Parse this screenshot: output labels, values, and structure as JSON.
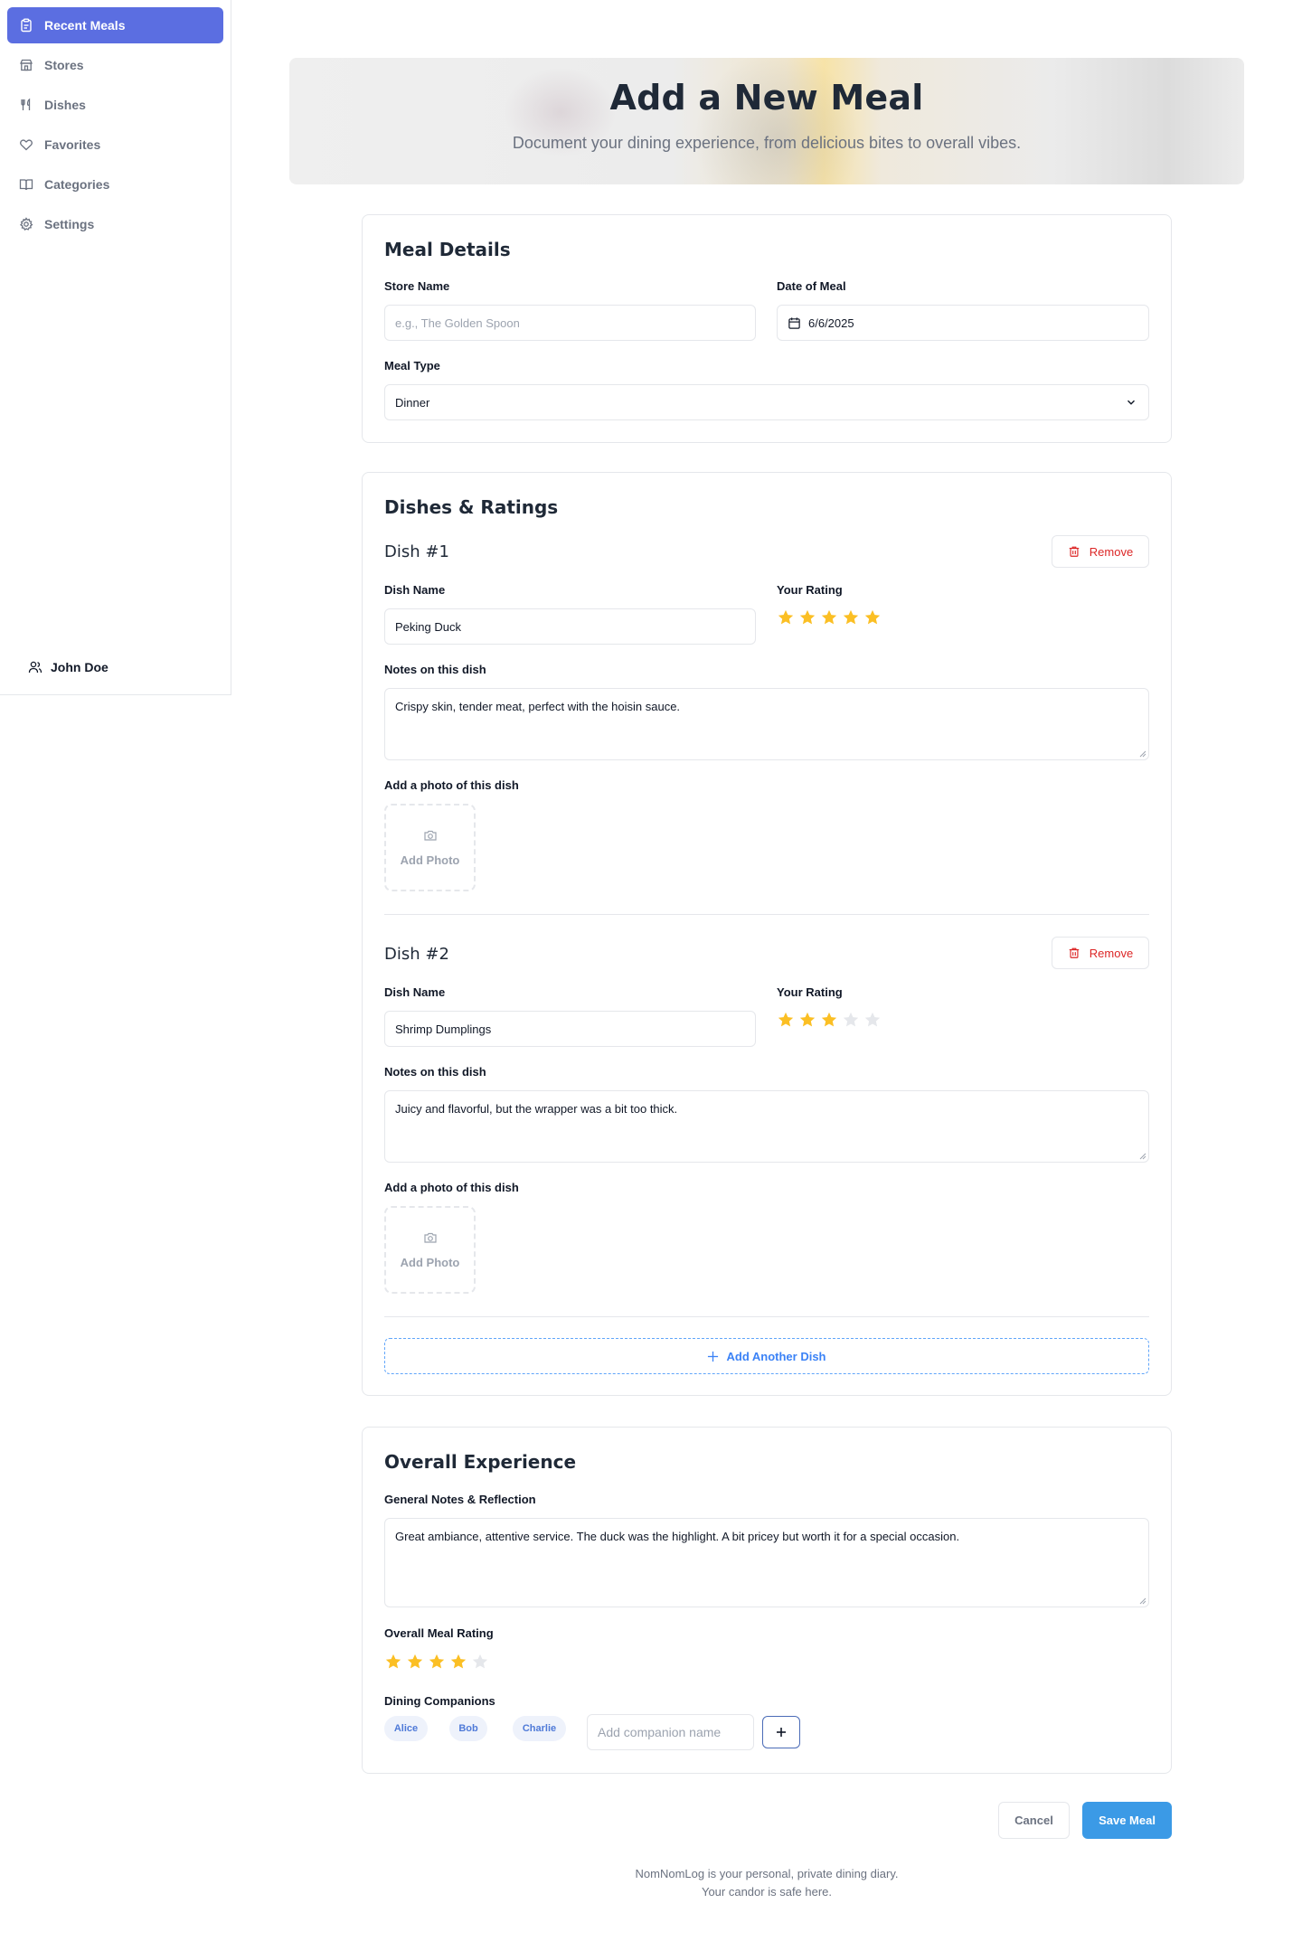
{
  "sidebar": {
    "items": [
      {
        "label": "Recent Meals",
        "icon": "clipboard-icon",
        "active": true
      },
      {
        "label": "Stores",
        "icon": "store-icon"
      },
      {
        "label": "Dishes",
        "icon": "utensils-icon"
      },
      {
        "label": "Favorites",
        "icon": "heart-icon"
      },
      {
        "label": "Categories",
        "icon": "book-icon"
      },
      {
        "label": "Settings",
        "icon": "gear-icon"
      }
    ],
    "user": {
      "name": "John Doe",
      "icon": "users-icon"
    }
  },
  "hero": {
    "title": "Add a New Meal",
    "subtitle": "Document your dining experience, from delicious bites to overall vibes."
  },
  "meal_details": {
    "title": "Meal Details",
    "store_label": "Store Name",
    "store_placeholder": "e.g., The Golden Spoon",
    "store_value": "",
    "date_label": "Date of Meal",
    "date_value": "6/6/2025",
    "meal_type_label": "Meal Type",
    "meal_type_value": "Dinner"
  },
  "dishes": {
    "title": "Dishes & Ratings",
    "items": [
      {
        "title": "Dish #1",
        "remove_label": "Remove",
        "name_label": "Dish Name",
        "name_value": "Peking Duck",
        "rating_label": "Your Rating",
        "rating": 5,
        "rating_max": 5,
        "notes_label": "Notes on this dish",
        "notes_value": "Crispy skin, tender meat, perfect with the hoisin sauce.",
        "photo_label": "Add a photo of this dish",
        "photo_button": "Add Photo"
      },
      {
        "title": "Dish #2",
        "remove_label": "Remove",
        "name_label": "Dish Name",
        "name_value": "Shrimp Dumplings",
        "rating_label": "Your Rating",
        "rating": 3,
        "rating_max": 5,
        "notes_label": "Notes on this dish",
        "notes_value": "Juicy and flavorful, but the wrapper was a bit too thick.",
        "photo_label": "Add a photo of this dish",
        "photo_button": "Add Photo"
      }
    ],
    "add_label": "Add Another Dish"
  },
  "overall": {
    "title": "Overall Experience",
    "notes_label": "General Notes & Reflection",
    "notes_value": "Great ambiance, attentive service. The duck was the highlight. A bit pricey but worth it for a special occasion.",
    "rating_label": "Overall Meal Rating",
    "rating": 4,
    "rating_max": 5,
    "companions_label": "Dining Companions",
    "companions": [
      "Alice",
      "Bob",
      "Charlie"
    ],
    "companion_placeholder": "Add companion name"
  },
  "actions": {
    "cancel": "Cancel",
    "save": "Save Meal"
  },
  "footer": {
    "line1": "NomNomLog is your personal, private dining diary.",
    "line2": "Your candor is safe here."
  },
  "colors": {
    "accent": "#5b6ee1",
    "primary_button": "#3b9ae6",
    "star_filled": "#fbbf24",
    "star_empty": "#e5e7eb",
    "danger": "#dc2626"
  }
}
